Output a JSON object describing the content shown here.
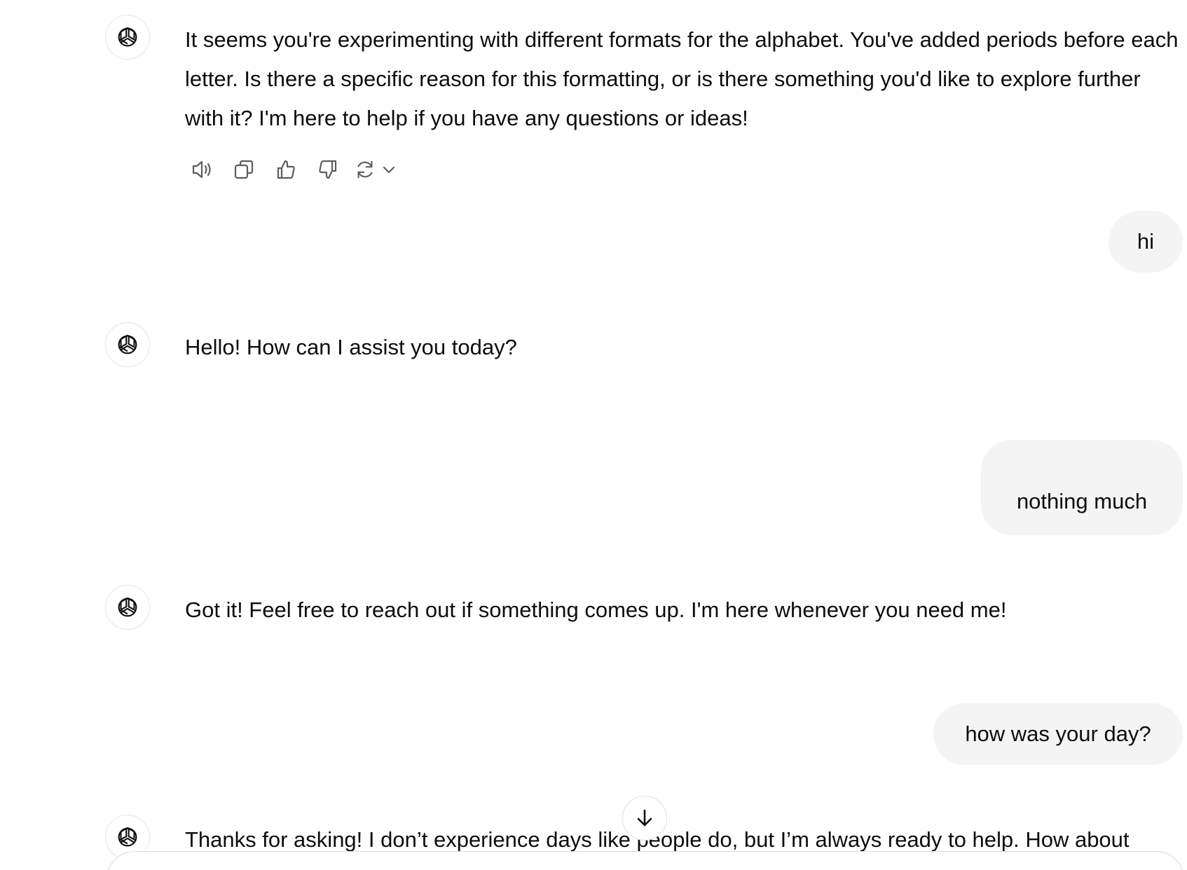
{
  "messages": [
    {
      "role": "assistant",
      "icon": "openai-logo-icon",
      "text": "It seems you're experimenting with different formats for the alphabet. You've added periods before each letter. Is there a specific reason for this formatting, or is there something you'd like to explore further with it? I'm here to help if you have any questions or ideas!",
      "actions": [
        "speaker-icon",
        "copy-icon",
        "thumbs-up-icon",
        "thumbs-down-icon",
        "regenerate-icon",
        "chevron-down-icon"
      ]
    },
    {
      "role": "user",
      "text": "hi"
    },
    {
      "role": "assistant",
      "icon": "openai-logo-icon",
      "text": "Hello! How can I assist you today?"
    },
    {
      "role": "user",
      "text": "nothing much"
    },
    {
      "role": "assistant",
      "icon": "openai-logo-icon",
      "text": "Got it! Feel free to reach out if something comes up. I'm here whenever you need me!"
    },
    {
      "role": "user",
      "text": "how was your day?"
    },
    {
      "role": "assistant",
      "icon": "openai-logo-icon",
      "text": "Thanks for asking! I don’t experience days like people do, but I’m always ready to help. How about"
    }
  ],
  "scroll_button_icon": "arrow-down-icon",
  "colors": {
    "user_bubble": "#f4f4f4",
    "text": "#0d0d0d",
    "icon": "#5d5d5d",
    "border": "#e6e6e6"
  }
}
